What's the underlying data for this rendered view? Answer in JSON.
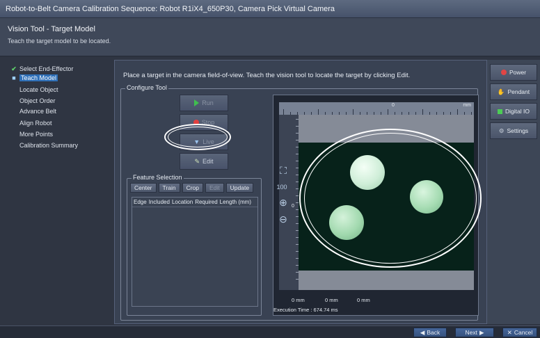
{
  "window": {
    "title": "Robot-to-Belt Camera Calibration Sequence: Robot R1iX4_650P30, Camera Pick Virtual Camera"
  },
  "header": {
    "title": "Vision Tool - Target Model",
    "subtitle": "Teach the target model to be located."
  },
  "steps": [
    {
      "label": "Select End-Effector",
      "state": "done"
    },
    {
      "label": "Teach Model",
      "state": "active"
    },
    {
      "label": "Locate Object",
      "state": "pending"
    },
    {
      "label": "Object Order",
      "state": "pending"
    },
    {
      "label": "Advance Belt",
      "state": "pending"
    },
    {
      "label": "Align Robot",
      "state": "pending"
    },
    {
      "label": "More Points",
      "state": "pending"
    },
    {
      "label": "Calibration Summary",
      "state": "pending"
    }
  ],
  "main": {
    "instructions": "Place a target in the camera field-of-view.  Teach the vision tool to locate the target by clicking Edit.",
    "configure_title": "Configure Tool",
    "tool_buttons": {
      "run": "Run",
      "stop": "Stop",
      "live": "Live",
      "edit": "Edit"
    },
    "feature_selection": {
      "title": "Feature Selection",
      "buttons": {
        "center": "Center",
        "train": "Train",
        "crop": "Crop",
        "edit": "Edit",
        "update": "Update"
      },
      "columns": [
        "Edge",
        "Included",
        "Location",
        "Required",
        "Length (mm)"
      ]
    },
    "viewer": {
      "unit_top": "mm",
      "ruler_zero": "0",
      "left_marker": "0",
      "zoom_label": "100",
      "bottom_labels": [
        "0 mm",
        "0 mm",
        "0 mm"
      ],
      "execution_time": "Execution Time : 674.74 ms",
      "scene_color": "#07221a",
      "puck_color": "#a8e6b4"
    }
  },
  "right": {
    "power": "Power",
    "pendant": "Pendant",
    "digital_io": "Digital IO",
    "settings": "Settings"
  },
  "footer": {
    "back": "Back",
    "next": "Next",
    "cancel": "Cancel"
  },
  "colors": {
    "accent": "#2e6fb7",
    "header_bg": "#3f4859",
    "annotation": "#ffffff"
  }
}
